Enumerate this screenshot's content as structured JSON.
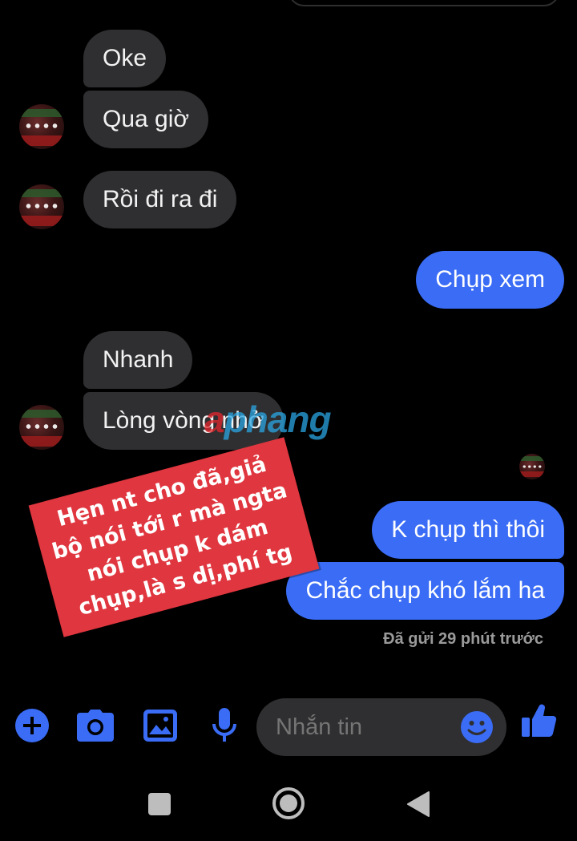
{
  "chat": {
    "messages": [
      {
        "id": "m1",
        "direction": "incoming",
        "text": "Oke"
      },
      {
        "id": "m2",
        "direction": "incoming",
        "text": "Qua giờ"
      },
      {
        "id": "m3",
        "direction": "incoming",
        "text": "Rồi đi ra đi"
      },
      {
        "id": "m4",
        "direction": "outgoing",
        "text": "Chụp xem"
      },
      {
        "id": "m5",
        "direction": "incoming",
        "text": "Nhanh"
      },
      {
        "id": "m6",
        "direction": "incoming",
        "text": "Lòng vòng nhở"
      },
      {
        "id": "m7",
        "direction": "outgoing",
        "text": "K chụp thì thôi"
      },
      {
        "id": "m8",
        "direction": "outgoing",
        "text": "Chắc chụp khó lắm ha"
      }
    ],
    "sent_status": "Đã gửi 29 phút trước"
  },
  "overlay": {
    "sticker_text": "Hẹn nt cho đã,giả\nbộ nói tới r mà ngta\nnói chụp k dám\nchụp,là s dị,phí tg",
    "watermark_part1": "a",
    "watermark_part2": "phang"
  },
  "composer": {
    "placeholder": "Nhắn tin"
  },
  "icons": {
    "add": "plus-circle-icon",
    "camera": "camera-icon",
    "gallery": "image-icon",
    "voice": "microphone-icon",
    "emoji": "emoji-icon",
    "like": "thumbs-up-icon"
  },
  "colors": {
    "background": "#000000",
    "incoming_bubble": "#2f2f31",
    "outgoing_bubble": "#3a6cf5",
    "accent": "#3a6cf5",
    "sticker": "#e0363f"
  }
}
